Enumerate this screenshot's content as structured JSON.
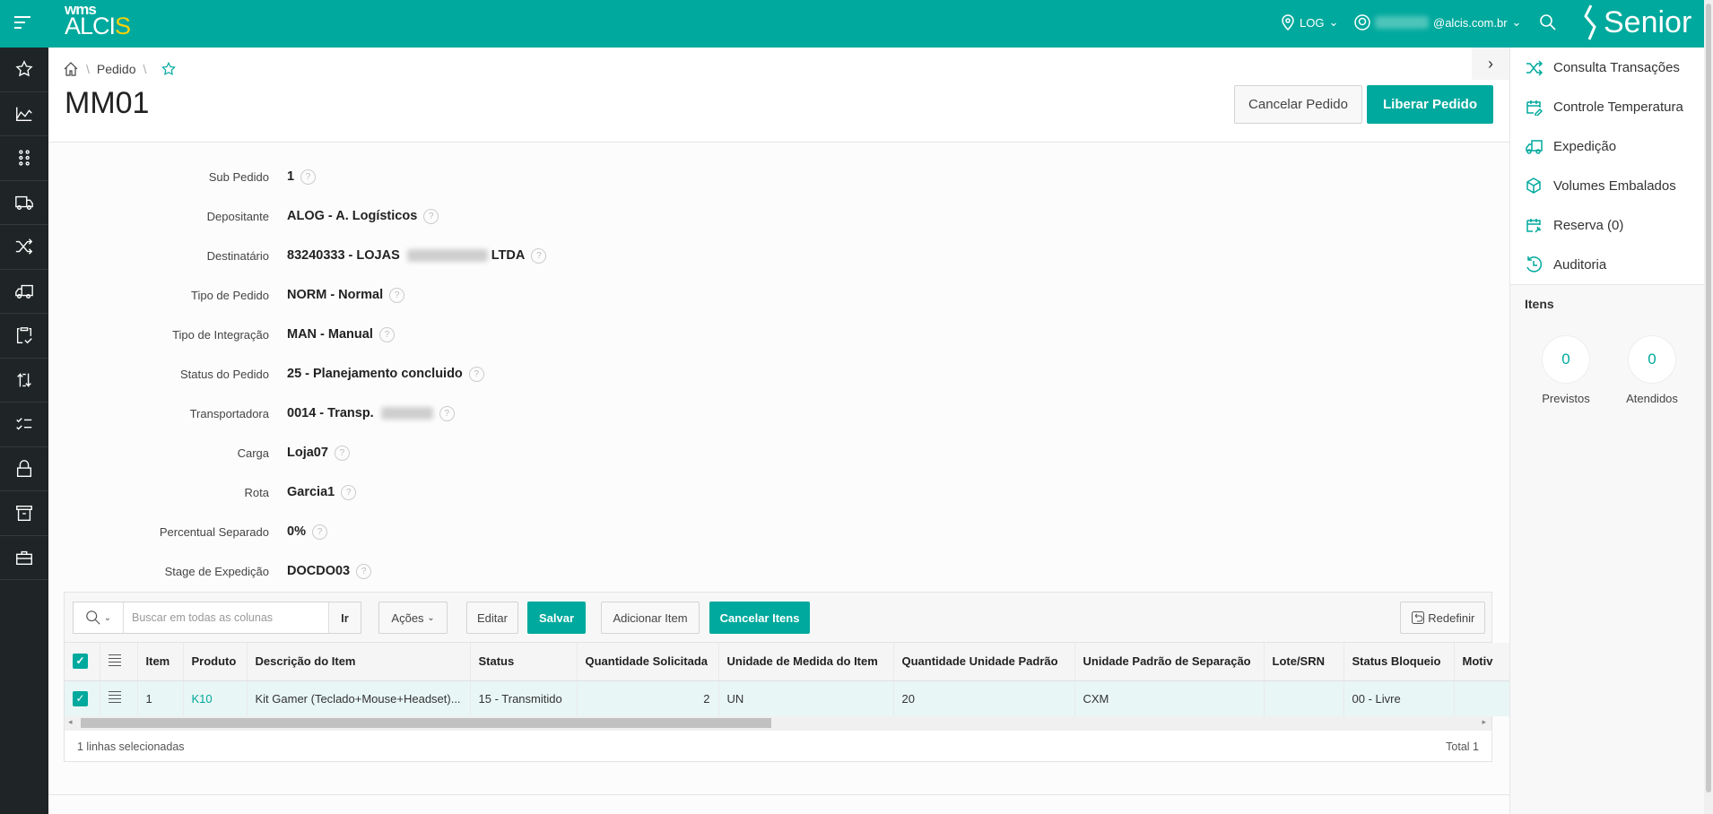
{
  "header": {
    "logo_top": "wms",
    "logo_main": "ALCI",
    "logo_accent": "S",
    "location": "LOG",
    "user_email_suffix": "@alcis.com.br",
    "brand": "Senior",
    "accent_color": "#00a99d"
  },
  "sidebar": {
    "icons": [
      "star-icon",
      "chart-line-icon",
      "apps-grid-icon",
      "truck-icon",
      "shuffle-icon",
      "delivery-truck-icon",
      "clipboard-check-icon",
      "sync-arrows-icon",
      "checklist-icon",
      "lock-icon",
      "archive-box-icon",
      "briefcase-icon"
    ]
  },
  "breadcrumb": {
    "items": [
      "Pedido"
    ]
  },
  "page": {
    "title": "MM01",
    "cancel_label": "Cancelar Pedido",
    "release_label": "Liberar Pedido"
  },
  "form": [
    {
      "label": "Sub Pedido",
      "value": "1"
    },
    {
      "label": "Depositante",
      "value": "ALOG - A. Logísticos"
    },
    {
      "label": "Destinatário",
      "value": "83240333 - LOJAS",
      "value_suffix": "LTDA"
    },
    {
      "label": "Tipo de Pedido",
      "value": "NORM - Normal"
    },
    {
      "label": "Tipo de Integração",
      "value": "MAN - Manual"
    },
    {
      "label": "Status do Pedido",
      "value": "25 - Planejamento concluido"
    },
    {
      "label": "Transportadora",
      "value": "0014 - Transp."
    },
    {
      "label": "Carga",
      "value": "Loja07"
    },
    {
      "label": "Rota",
      "value": "Garcia1"
    },
    {
      "label": "Percentual Separado",
      "value": "0%"
    },
    {
      "label": "Stage de Expedição",
      "value": "DOCDO03"
    }
  ],
  "help_glyph": "?",
  "grid": {
    "search_placeholder": "Buscar em todas as colunas",
    "go_label": "Ir",
    "actions_label": "Ações",
    "edit_label": "Editar",
    "save_label": "Salvar",
    "add_label": "Adicionar Item",
    "cancel_items_label": "Cancelar Itens",
    "reset_label": "Redefinir",
    "columns": [
      "Item",
      "Produto",
      "Descrição do Item",
      "Status",
      "Quantidade Solicitada",
      "Unidade de Medida do Item",
      "Quantidade Unidade Padrão",
      "Unidade Padrão de Separação",
      "Lote/SRN",
      "Status Bloqueio",
      "Motiv"
    ],
    "rows": [
      {
        "item": "1",
        "produto": "K10",
        "descricao": "Kit Gamer (Teclado+Mouse+Headset)...",
        "status": "15 - Transmitido",
        "qtd": "2",
        "unidade": "UN",
        "qtd_padrao": "20",
        "un_sep": "CXM",
        "lote": "",
        "status_bloqueio": "00 - Livre",
        "motivo": "",
        "selected": true
      }
    ],
    "selected_text": "1 linhas selecionadas",
    "total_text": "Total 1"
  },
  "right_panel": {
    "items": [
      {
        "label": "Consulta Transações",
        "icon": "shuffle-icon"
      },
      {
        "label": "Controle Temperatura",
        "icon": "calendar-edit-icon"
      },
      {
        "label": "Expedição",
        "icon": "truck-icon"
      },
      {
        "label": "Volumes Embalados",
        "icon": "box-icon"
      },
      {
        "label": "Reserva (0)",
        "icon": "calendar-tool-icon"
      },
      {
        "label": "Auditoria",
        "icon": "history-icon"
      }
    ],
    "section_title": "Itens",
    "counters": [
      {
        "value": "0",
        "label": "Previstos"
      },
      {
        "value": "0",
        "label": "Atendidos"
      }
    ]
  }
}
